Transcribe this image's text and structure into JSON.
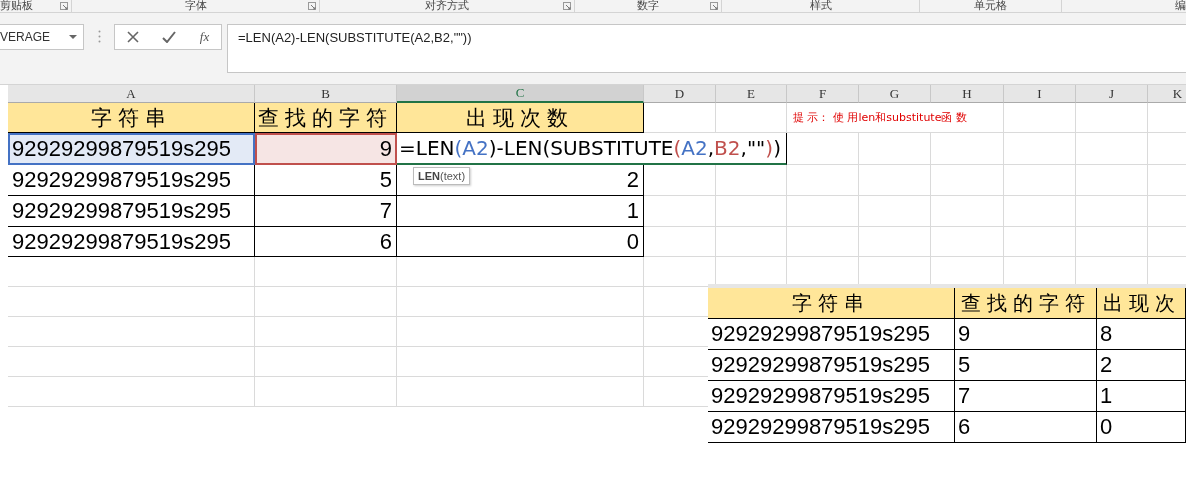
{
  "ribbon_groups": [
    {
      "label": "剪贴板",
      "launcher": true
    },
    {
      "label": "字体",
      "launcher": true
    },
    {
      "label": "对齐方式",
      "launcher": true
    },
    {
      "label": "数字",
      "launcher": true
    },
    {
      "label": "样式",
      "launcher": false
    },
    {
      "label": "单元格",
      "launcher": false
    },
    {
      "label": "编",
      "launcher": false
    }
  ],
  "name_box": {
    "value": "VERAGE"
  },
  "formula_bar": {
    "fx": "fx",
    "formula": "=LEN(A2)-LEN(SUBSTITUTE(A2,B2,\"\"))"
  },
  "columns": [
    {
      "label": "A",
      "selected": false
    },
    {
      "label": "B",
      "selected": false
    },
    {
      "label": "C",
      "selected": true
    },
    {
      "label": "D",
      "selected": false
    },
    {
      "label": "E",
      "selected": false
    },
    {
      "label": "F",
      "selected": false
    },
    {
      "label": "G",
      "selected": false
    },
    {
      "label": "H",
      "selected": false
    },
    {
      "label": "I",
      "selected": false
    },
    {
      "label": "J",
      "selected": false
    },
    {
      "label": "K",
      "selected": false
    }
  ],
  "table": {
    "headers": [
      "字符串",
      "查找的字符",
      "出现次数"
    ],
    "rows": [
      [
        {
          "text": "92929299879519s295",
          "color": "#4472c4"
        },
        {
          "text": "9",
          "color": "#c0504d"
        },
        {
          "kind": "editing"
        }
      ],
      [
        {
          "text": "92929299879519s295"
        },
        {
          "text": "5"
        },
        {
          "text": "2"
        }
      ],
      [
        {
          "text": "92929299879519s295"
        },
        {
          "text": "7"
        },
        {
          "text": "1"
        }
      ],
      [
        {
          "text": "92929299879519s295"
        },
        {
          "text": "6"
        },
        {
          "text": "0"
        }
      ]
    ]
  },
  "editor": {
    "segments": [
      {
        "text": "=LEN",
        "color": "#000000"
      },
      {
        "text": "(A2",
        "color": "#4472c4"
      },
      {
        "text": ")-LEN(SUBSTITUTE",
        "color": "#000000"
      },
      {
        "text": "(",
        "color": "#c0504d"
      },
      {
        "text": "A2",
        "color": "#4472c4"
      },
      {
        "text": ",",
        "color": "#000000"
      },
      {
        "text": "B2",
        "color": "#c0504d"
      },
      {
        "text": ",\"\"",
        "color": "#000000"
      },
      {
        "text": ")",
        "color": "#c0504d"
      },
      {
        "text": ")",
        "color": "#000000"
      }
    ],
    "tooltip": {
      "function": "LEN",
      "args": "(text)"
    }
  },
  "hint": "提 示： 使 用len和substitute函 数",
  "pasted_table": {
    "headers": [
      "字符串",
      "查找的字符",
      "出现次"
    ],
    "rows": [
      [
        "92929299879519s295",
        "9",
        "8"
      ],
      [
        "92929299879519s295",
        "5",
        "2"
      ],
      [
        "92929299879519s295",
        "7",
        "1"
      ],
      [
        "92929299879519s295",
        "6",
        "0"
      ]
    ]
  }
}
